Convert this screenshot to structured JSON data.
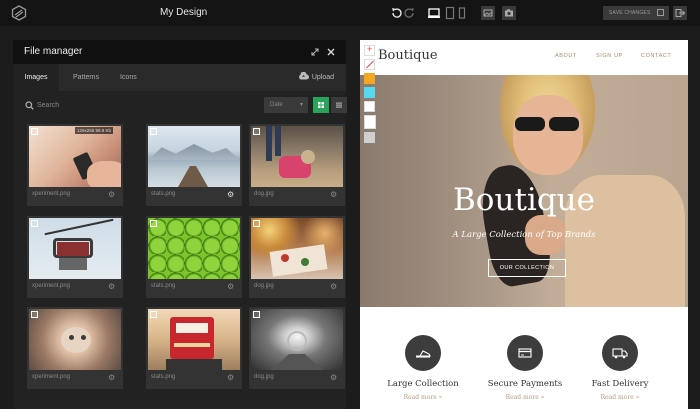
{
  "app": {
    "title": "My Design",
    "save_label": "SAVE CHANGES"
  },
  "icons": [
    "logo-icon",
    "undo-icon",
    "redo-icon",
    "desktop-icon",
    "tablet-icon",
    "phone-icon",
    "image-icon",
    "camera-icon",
    "save-icon",
    "exit-icon"
  ],
  "file_manager": {
    "title": "File manager",
    "tabs": [
      "Images",
      "Patterns",
      "Icons"
    ],
    "active_tab": "Images",
    "upload_label": "Upload",
    "search_placeholder": "Search",
    "sort_value": "Date",
    "files": [
      {
        "name": "xperiment.png",
        "badge": "125x256   59.9 Kb"
      },
      {
        "name": "stats.png"
      },
      {
        "name": "dog.jpg"
      },
      {
        "name": "xperiment.png"
      },
      {
        "name": "stats.png"
      },
      {
        "name": "dog.jpg"
      },
      {
        "name": "xperiment.png"
      },
      {
        "name": "stats.png"
      },
      {
        "name": "dog.jpg"
      }
    ]
  },
  "colors": {
    "accent_green": "#27a35a",
    "swatch_orange": "#f5a623",
    "swatch_cyan": "#55d9f0",
    "brand_gold": "#b08a64"
  },
  "preview": {
    "brand": "Boutique",
    "nav": [
      "ABOUT",
      "SIGN UP",
      "CONTACT"
    ],
    "hero_title": "Boutique",
    "hero_subtitle": "A Large Collection of Top Brands",
    "hero_cta": "OUR COLLECTION",
    "features": [
      {
        "title": "Large Collection",
        "link": "Read more »"
      },
      {
        "title": "Secure Payments",
        "link": "Read more »"
      },
      {
        "title": "Fast Delivery",
        "link": "Read more »"
      }
    ]
  }
}
